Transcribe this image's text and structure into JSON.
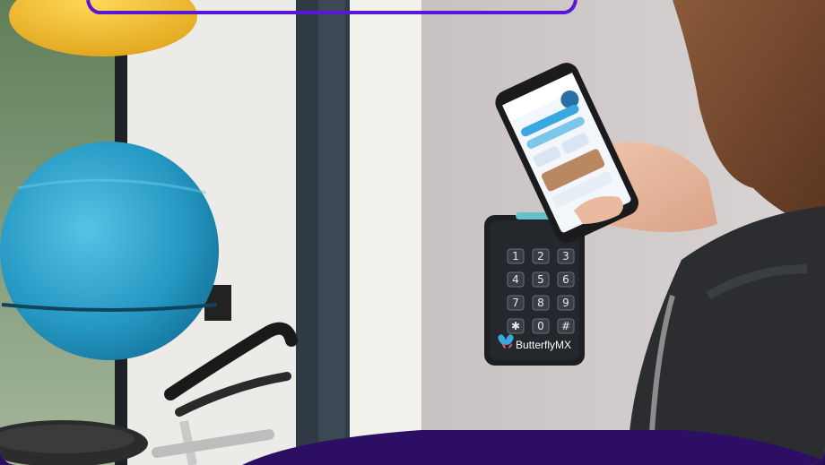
{
  "reader": {
    "brand_name": "ButterflyMX",
    "keys": [
      "1",
      "2",
      "3",
      "4",
      "5",
      "6",
      "7",
      "8",
      "9",
      "✱",
      "0",
      "#"
    ]
  },
  "colors": {
    "accent_purple": "#5a16d6",
    "bottom_band": "#2c0e64",
    "wall": "#cfc9c9",
    "ball_blue": "#2aa0c8",
    "ball_yellow": "#f0c033",
    "reader_body": "#1c1e22",
    "reader_led": "#5fc3c8"
  },
  "icons": [
    "butterfly-logo-icon",
    "exercise-ball-icon",
    "phone-icon"
  ]
}
